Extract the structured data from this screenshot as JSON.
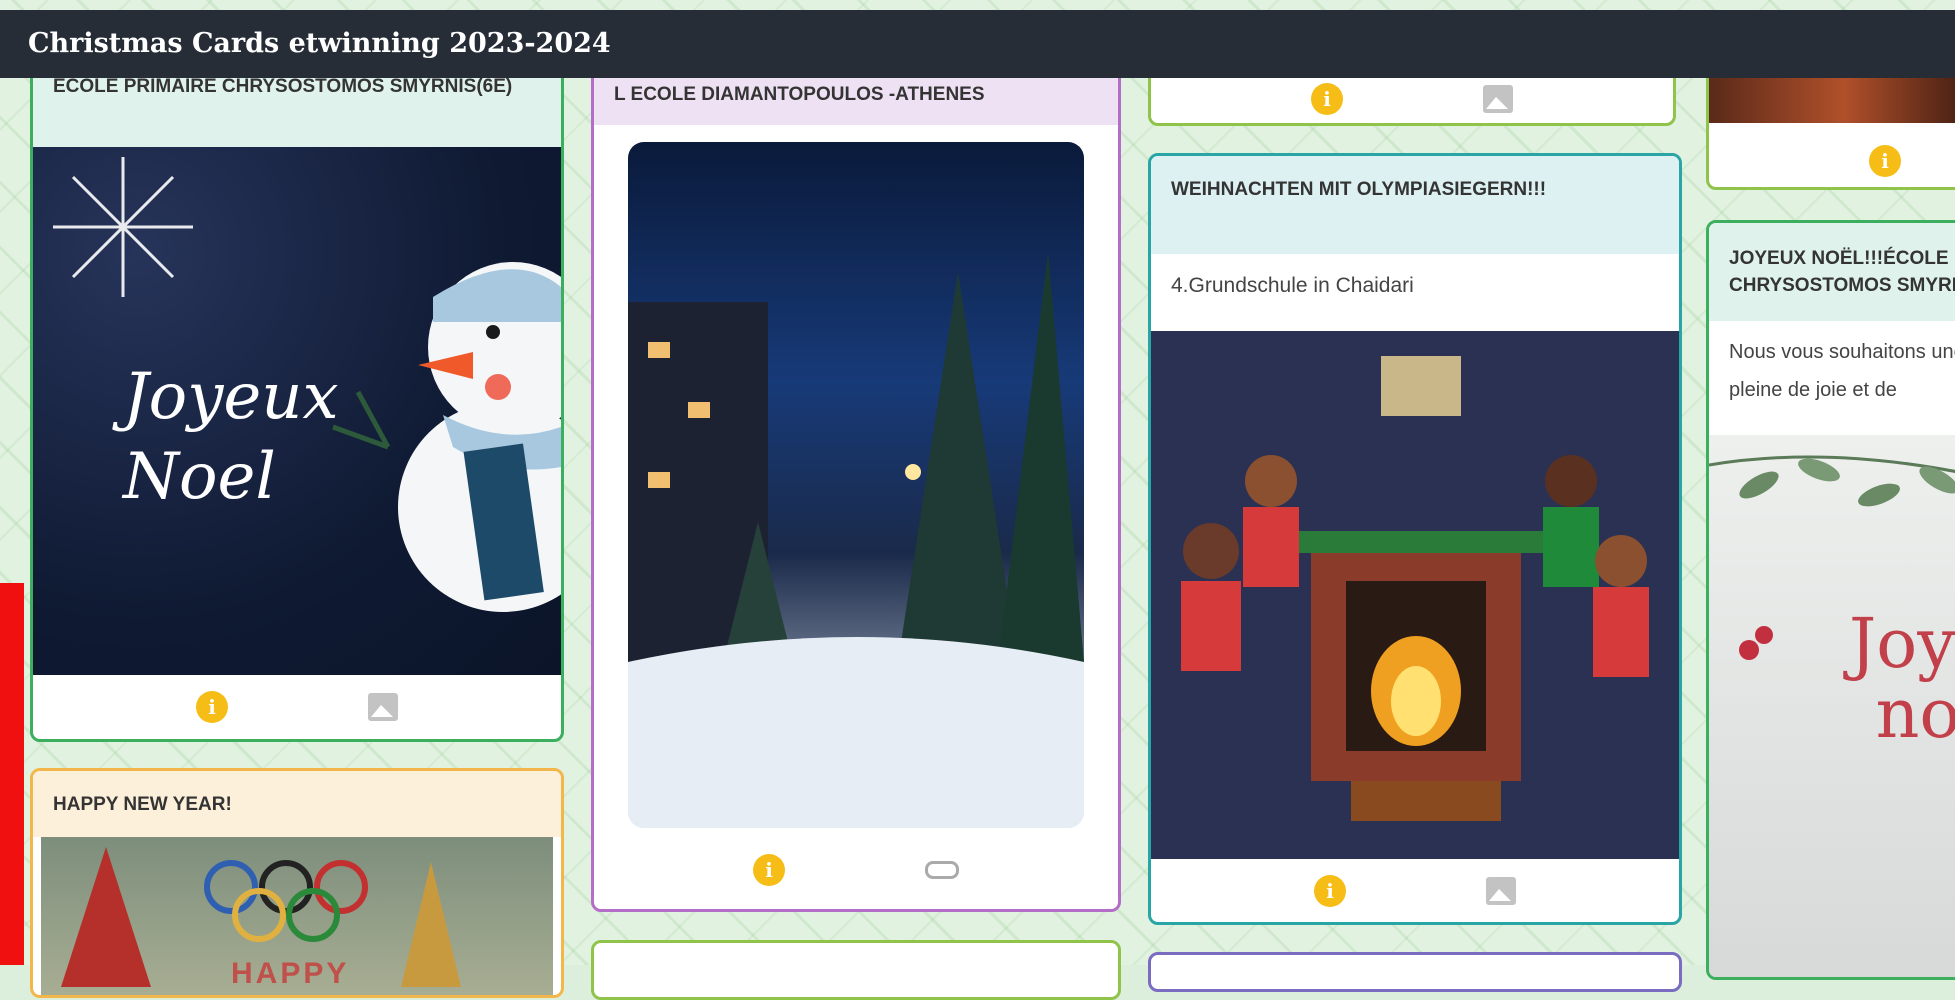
{
  "topbar": {
    "title": "Christmas Cards etwinning 2023-2024"
  },
  "cards": {
    "c1": {
      "title": "ECOLE PRIMAIRE CHRYSOSTOMOS SMYRNIS(6E)",
      "image_text": "Joyeux Noel"
    },
    "c2": {
      "title": "HAPPY NEW YEAR!",
      "image_text": "HAPPY"
    },
    "c3": {
      "title": "L ECOLE DIAMANTOPOULOS -ATHENES"
    },
    "c4": {
      "title": "WEIHNACHTEN MIT OLYMPIASIEGERN!!!",
      "description": "4.Grundschule in Chaidari"
    },
    "c5": {
      "title": "JOYEUX NOËL!!!ÉCOLE PRIMAIRE CHRYSOSTOMOS SMYRNIS",
      "description": "Nous vous souhaitons une année pleine de joie et de",
      "image_text": "Joyeux noël"
    }
  },
  "icons": {
    "info": "info-icon",
    "image": "image-icon",
    "link": "link-icon"
  },
  "colors": {
    "topbar": "#262d36",
    "accent_green": "#3caf5e",
    "accent_orange": "#f2b64a",
    "accent_purple": "#b56ec8",
    "info_yellow": "#f7bd17"
  }
}
